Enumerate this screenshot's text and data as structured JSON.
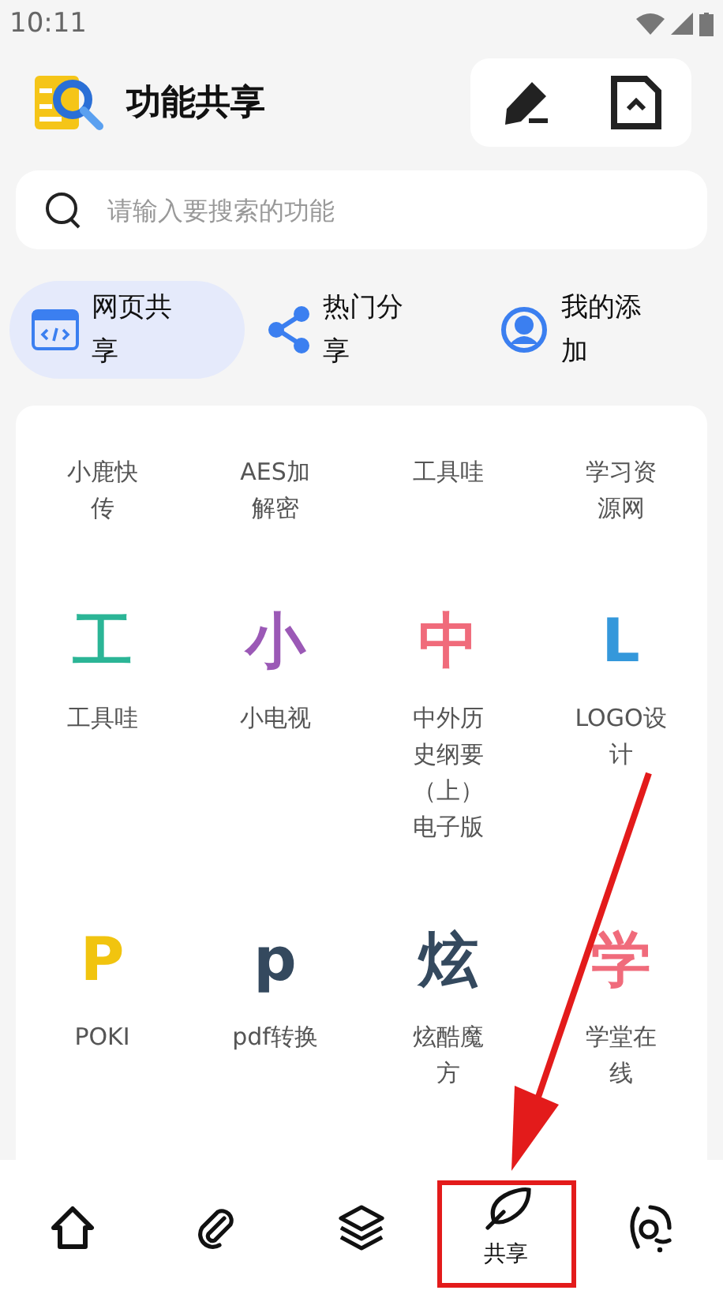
{
  "status_bar": {
    "time": "10:11"
  },
  "header": {
    "title": "功能共享"
  },
  "search": {
    "placeholder": "请输入要搜索的功能"
  },
  "tabs": [
    {
      "label": "网页共享",
      "selected": true,
      "kind": "web"
    },
    {
      "label": "热门分享",
      "selected": false,
      "kind": "share"
    },
    {
      "label": "我的添加",
      "selected": false,
      "kind": "user"
    }
  ],
  "grid": [
    {
      "label": "小鹿快传"
    },
    {
      "label": "AES加解密"
    },
    {
      "label": "工具哇"
    },
    {
      "label": "学习资源网"
    },
    {
      "glyph": "工",
      "color": "#2bb596",
      "label": "工具哇"
    },
    {
      "glyph": "小",
      "color": "#9b59b6",
      "label": "小电视"
    },
    {
      "glyph": "中",
      "color": "#f06b7b",
      "label": "中外历史纲要（上）电子版"
    },
    {
      "glyph": "L",
      "color": "#3498db",
      "label": "LOGO设计"
    },
    {
      "glyph": "P",
      "color": "#f1c40f",
      "label": "POKI"
    },
    {
      "glyph": "p",
      "color": "#34495e",
      "label": "pdf转换"
    },
    {
      "glyph": "炫",
      "color": "#34495e",
      "label": "炫酷魔方"
    },
    {
      "glyph": "学",
      "color": "#f06b7b",
      "label": "学堂在线"
    }
  ],
  "nav": [
    {
      "kind": "home"
    },
    {
      "kind": "clip"
    },
    {
      "kind": "layers"
    },
    {
      "kind": "leaf",
      "label": "共享"
    },
    {
      "kind": "dial"
    }
  ]
}
